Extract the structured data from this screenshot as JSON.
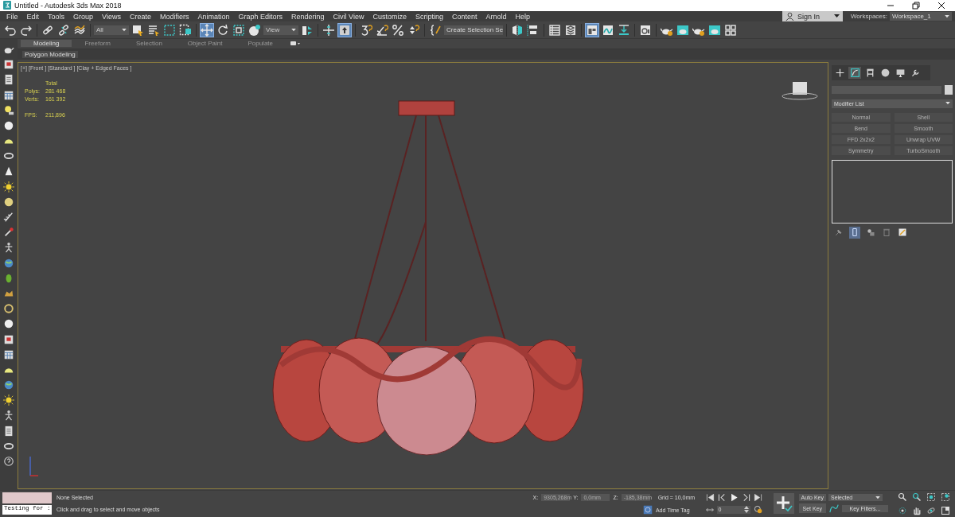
{
  "window": {
    "title": "Untitled - Autodesk 3ds Max 2018"
  },
  "menu": [
    "File",
    "Edit",
    "Tools",
    "Group",
    "Views",
    "Create",
    "Modifiers",
    "Animation",
    "Graph Editors",
    "Rendering",
    "Civil View",
    "Customize",
    "Scripting",
    "Content",
    "Arnold",
    "Help"
  ],
  "account": {
    "sign_in": "Sign In",
    "workspaces_label": "Workspaces:",
    "workspace": "Workspace_1"
  },
  "toolbar": [
    [
      {
        "kind": "undo",
        "selected": false
      },
      {
        "kind": "redo",
        "selected": false
      }
    ],
    [
      {
        "kind": "link",
        "selected": false
      },
      {
        "kind": "unlink",
        "selected": false
      },
      {
        "kind": "wave",
        "selected": false
      }
    ],
    [
      {
        "kind": "dropdown",
        "value": "All"
      },
      {
        "kind": "arrow",
        "selected": false
      },
      {
        "kind": "list",
        "selected": false
      },
      {
        "kind": "dashrect",
        "selected": false
      },
      {
        "kind": "dashfill",
        "selected": false
      }
    ],
    [
      {
        "kind": "move",
        "selected": true
      },
      {
        "kind": "rotate",
        "selected": false
      },
      {
        "kind": "scale",
        "selected": false
      },
      {
        "kind": "ball",
        "selected": false
      },
      {
        "kind": "dropdown",
        "value": "View"
      },
      {
        "kind": "pivot",
        "selected": false
      }
    ],
    [
      {
        "kind": "cross",
        "selected": false
      },
      {
        "kind": "pin",
        "selected": true
      }
    ],
    [
      {
        "kind": "snap",
        "selected": false
      },
      {
        "kind": "angle",
        "selected": false
      },
      {
        "kind": "percent",
        "selected": false
      },
      {
        "kind": "spinner",
        "selected": false
      }
    ],
    [
      {
        "kind": "brace",
        "selected": false
      },
      {
        "kind": "field",
        "value": "Create Selection Se"
      }
    ],
    [
      {
        "kind": "mirror",
        "selected": false
      },
      {
        "kind": "align",
        "selected": false
      }
    ],
    [
      {
        "kind": "table",
        "selected": false
      },
      {
        "kind": "layers",
        "selected": false
      }
    ],
    [
      {
        "kind": "layout",
        "selected": true
      },
      {
        "kind": "curve",
        "selected": false
      },
      {
        "kind": "download",
        "selected": false
      }
    ],
    [
      {
        "kind": "panel",
        "selected": false
      }
    ],
    [
      {
        "kind": "teapot",
        "selected": false
      },
      {
        "kind": "teapotframe",
        "selected": false
      },
      {
        "kind": "teapot",
        "selected": false
      },
      {
        "kind": "teapotframe",
        "selected": false
      },
      {
        "kind": "grid",
        "selected": false
      }
    ]
  ],
  "ribbon": {
    "tabs": [
      {
        "label": "Modeling",
        "selected": true
      },
      {
        "label": "Freeform",
        "selected": false
      },
      {
        "label": "Selection",
        "selected": false
      },
      {
        "label": "Object Paint",
        "selected": false
      },
      {
        "label": "Populate",
        "selected": false
      }
    ],
    "panel": "Polygon Modeling"
  },
  "viewport": {
    "labels": [
      "[+]",
      "[Front ]",
      "[Standard ]",
      "[Clay + Edged Faces ]"
    ],
    "stats_header": "Total",
    "stats": [
      {
        "label": "Polys:",
        "value": "281 468"
      },
      {
        "label": "Verts:",
        "value": "161 392"
      }
    ],
    "fps": {
      "label": "FPS:",
      "value": "211,896"
    },
    "scene": {
      "kind": "picture"
    }
  },
  "command_panel": {
    "tabs": [
      {
        "kind": "create",
        "selected": false
      },
      {
        "kind": "modify",
        "selected": true
      },
      {
        "kind": "hierarchy",
        "selected": false
      },
      {
        "kind": "motion",
        "selected": false
      },
      {
        "kind": "display",
        "selected": false
      },
      {
        "kind": "utilities",
        "selected": false
      }
    ],
    "modifier_list": "Modifier List",
    "modifiers": [
      "Normal",
      "Shell",
      "Bend",
      "Smooth",
      "FFD 2x2x2",
      "Unwrap UVW",
      "Symmetry",
      "TurboSmooth"
    ],
    "stack_tools": [
      {
        "kind": "pin",
        "selected": false
      },
      {
        "kind": "result",
        "selected": true
      },
      {
        "kind": "unique",
        "selected": false
      },
      {
        "kind": "remove",
        "selected": false
      },
      {
        "kind": "configure",
        "selected": false
      }
    ]
  },
  "status": {
    "listener": "Testing for :",
    "selection": "None Selected",
    "prompt": "Click and drag to select and move objects",
    "coords": [
      {
        "label": "X:",
        "value": "9305,268m"
      },
      {
        "label": "Y:",
        "value": "0,0mm"
      },
      {
        "label": "Z:",
        "value": "-185,38mm"
      }
    ],
    "grid": "Grid = 10,0mm",
    "time_tag": "Add Time Tag",
    "frame": "0",
    "auto_key": "Auto Key",
    "set_key": "Set Key",
    "key_mode": "Selected",
    "key_filters": "Key Filters..."
  }
}
